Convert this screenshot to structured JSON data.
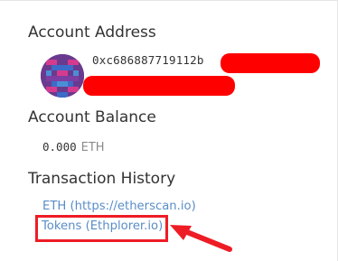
{
  "account": {
    "address_heading": "Account Address",
    "address_visible": "0xc686887719112b",
    "balance_heading": "Account Balance",
    "balance_value": "0.000",
    "balance_unit": "ETH"
  },
  "history": {
    "heading": "Transaction History",
    "links": [
      {
        "label": "ETH (https://etherscan.io)"
      },
      {
        "label": "Tokens (Ethplorer.io)"
      }
    ]
  },
  "icons": {
    "avatar": "identicon-avatar",
    "annotation": "red-arrow-icon"
  },
  "colors": {
    "link": "#5a8dc8",
    "heading": "#333333",
    "annotation": "#ee1c25",
    "redaction": "#ff0000"
  }
}
